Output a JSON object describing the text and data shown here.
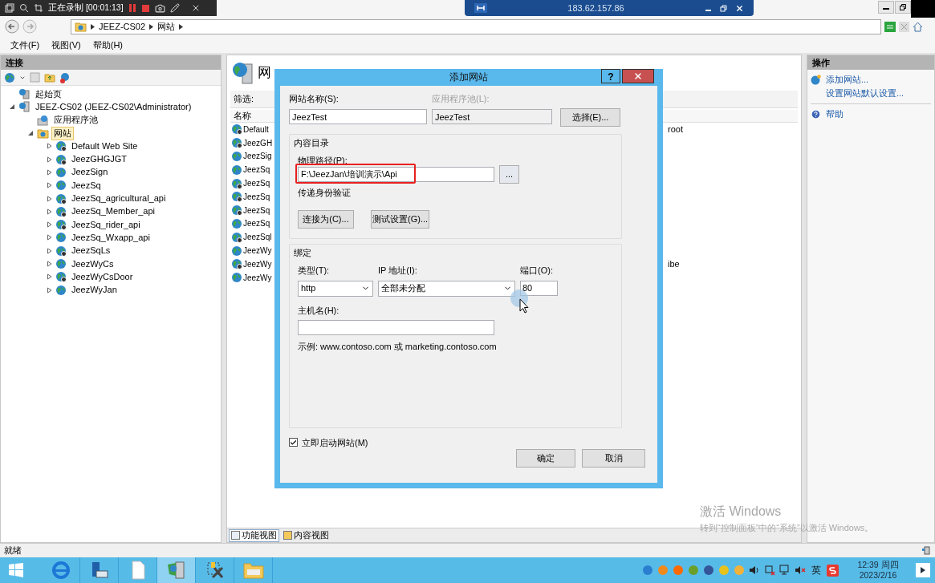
{
  "recorder": {
    "status": "正在录制 [00:01:13]"
  },
  "remote_bar": {
    "address": "183.62.157.86"
  },
  "address_bar": {
    "crumbs": [
      "JEEZ-CS02",
      "网站"
    ]
  },
  "menu": [
    "文件(F)",
    "视图(V)",
    "帮助(H)"
  ],
  "connections": {
    "title": "连接",
    "tree": [
      {
        "label": "起始页",
        "kind": "start"
      },
      {
        "label": "JEEZ-CS02 (JEEZ-CS02\\Administrator)",
        "kind": "server",
        "expanded": true,
        "selected": false,
        "children": [
          {
            "label": "应用程序池",
            "kind": "pools",
            "selected": false
          },
          {
            "label": "网站",
            "kind": "sites",
            "expanded": true,
            "selected": true,
            "children": [
              {
                "label": "Default Web Site",
                "kind": "site",
                "stopped": true,
                "expanded": false,
                "selected": false
              },
              {
                "label": "JeezGHGJGT",
                "kind": "site",
                "stopped": true,
                "expanded": false,
                "selected": false
              },
              {
                "label": "JeezSign",
                "kind": "site",
                "stopped": false,
                "expanded": false,
                "selected": false
              },
              {
                "label": "JeezSq",
                "kind": "site",
                "stopped": false,
                "expanded": false,
                "selected": false
              },
              {
                "label": "JeezSq_agricultural_api",
                "kind": "site",
                "stopped": true,
                "expanded": false,
                "selected": false
              },
              {
                "label": "JeezSq_Member_api",
                "kind": "site",
                "stopped": true,
                "expanded": false,
                "selected": false
              },
              {
                "label": "JeezSq_rider_api",
                "kind": "site",
                "stopped": true,
                "expanded": false,
                "selected": false
              },
              {
                "label": "JeezSq_Wxapp_api",
                "kind": "site",
                "stopped": false,
                "expanded": false,
                "selected": false
              },
              {
                "label": "JeezSqLs",
                "kind": "site",
                "stopped": true,
                "expanded": false,
                "selected": false
              },
              {
                "label": "JeezWyCs",
                "kind": "site",
                "stopped": false,
                "expanded": false,
                "selected": false
              },
              {
                "label": "JeezWyCsDoor",
                "kind": "site",
                "stopped": true,
                "expanded": false,
                "selected": false
              },
              {
                "label": "JeezWyJan",
                "kind": "site",
                "stopped": false,
                "expanded": false,
                "selected": false
              }
            ]
          }
        ]
      }
    ]
  },
  "sites_page": {
    "title": "网",
    "filter_label": "筛选:",
    "column": "名称",
    "rows": [
      {
        "name": "Default",
        "stopped": true,
        "column_2": "root"
      },
      {
        "name": "JeezGH",
        "stopped": true
      },
      {
        "name": "JeezSig",
        "stopped": false
      },
      {
        "name": "JeezSq",
        "stopped": false
      },
      {
        "name": "JeezSq",
        "stopped": true
      },
      {
        "name": "JeezSq",
        "stopped": true
      },
      {
        "name": "JeezSq",
        "stopped": true
      },
      {
        "name": "JeezSq",
        "stopped": false
      },
      {
        "name": "JeezSql",
        "stopped": true
      },
      {
        "name": "JeezWy",
        "stopped": false
      },
      {
        "name": "JeezWy",
        "stopped": true,
        "column_2": "ibe"
      },
      {
        "name": "JeezWy",
        "stopped": false
      }
    ],
    "view_tabs": [
      {
        "label": "功能视图",
        "selected": true
      },
      {
        "label": "内容视图",
        "selected": false
      }
    ]
  },
  "actions": {
    "title": "操作",
    "items": [
      {
        "label": "添加网站...",
        "kind": "add"
      },
      {
        "label": "设置网站默认设置...",
        "kind": "plain"
      },
      {
        "label": "帮助",
        "kind": "help"
      }
    ]
  },
  "activation": {
    "title": "激活 Windows",
    "hint": "转到“控制面板”中的“系统”以激活 Windows。"
  },
  "status_bar": "就绪",
  "dialog": {
    "title": "添加网站",
    "help": "?",
    "site_name": {
      "label": "网站名称(S):",
      "value": "JeezTest"
    },
    "app_pool": {
      "label": "应用程序池(L):",
      "value": "JeezTest",
      "disabled": true
    },
    "select_button": "选择(E)...",
    "content_group": "内容目录",
    "path": {
      "label": "物理路径(P):",
      "value": "F:\\JeezJan\\培训演示\\Api",
      "highlighted": true
    },
    "browse_button": "...",
    "auth_label": "传递身份验证",
    "connect_button": "连接为(C)...",
    "test_button": "测试设置(G)...",
    "binding_group": "绑定",
    "type": {
      "label": "类型(T):",
      "value": "http"
    },
    "ip": {
      "label": "IP 地址(I):",
      "value": "全部未分配"
    },
    "port": {
      "label": "端口(O):",
      "value": "80"
    },
    "host": {
      "label": "主机名(H):"
    },
    "example": "示例: www.contoso.com 或 marketing.contoso.com",
    "start_now": {
      "label": "立即启动网站(M)",
      "checked": true
    },
    "ok": "确定",
    "cancel": "取消"
  },
  "taskbar": {
    "apps": [
      {
        "kind": "ie",
        "selected": false
      },
      {
        "kind": "server",
        "selected": false
      },
      {
        "kind": "file",
        "selected": false
      },
      {
        "kind": "iis",
        "selected": true
      },
      {
        "kind": "tools",
        "selected": false
      },
      {
        "kind": "folder",
        "selected": false
      }
    ],
    "ime": "英",
    "time": "12:39 周四",
    "date": "2023/2/16"
  }
}
